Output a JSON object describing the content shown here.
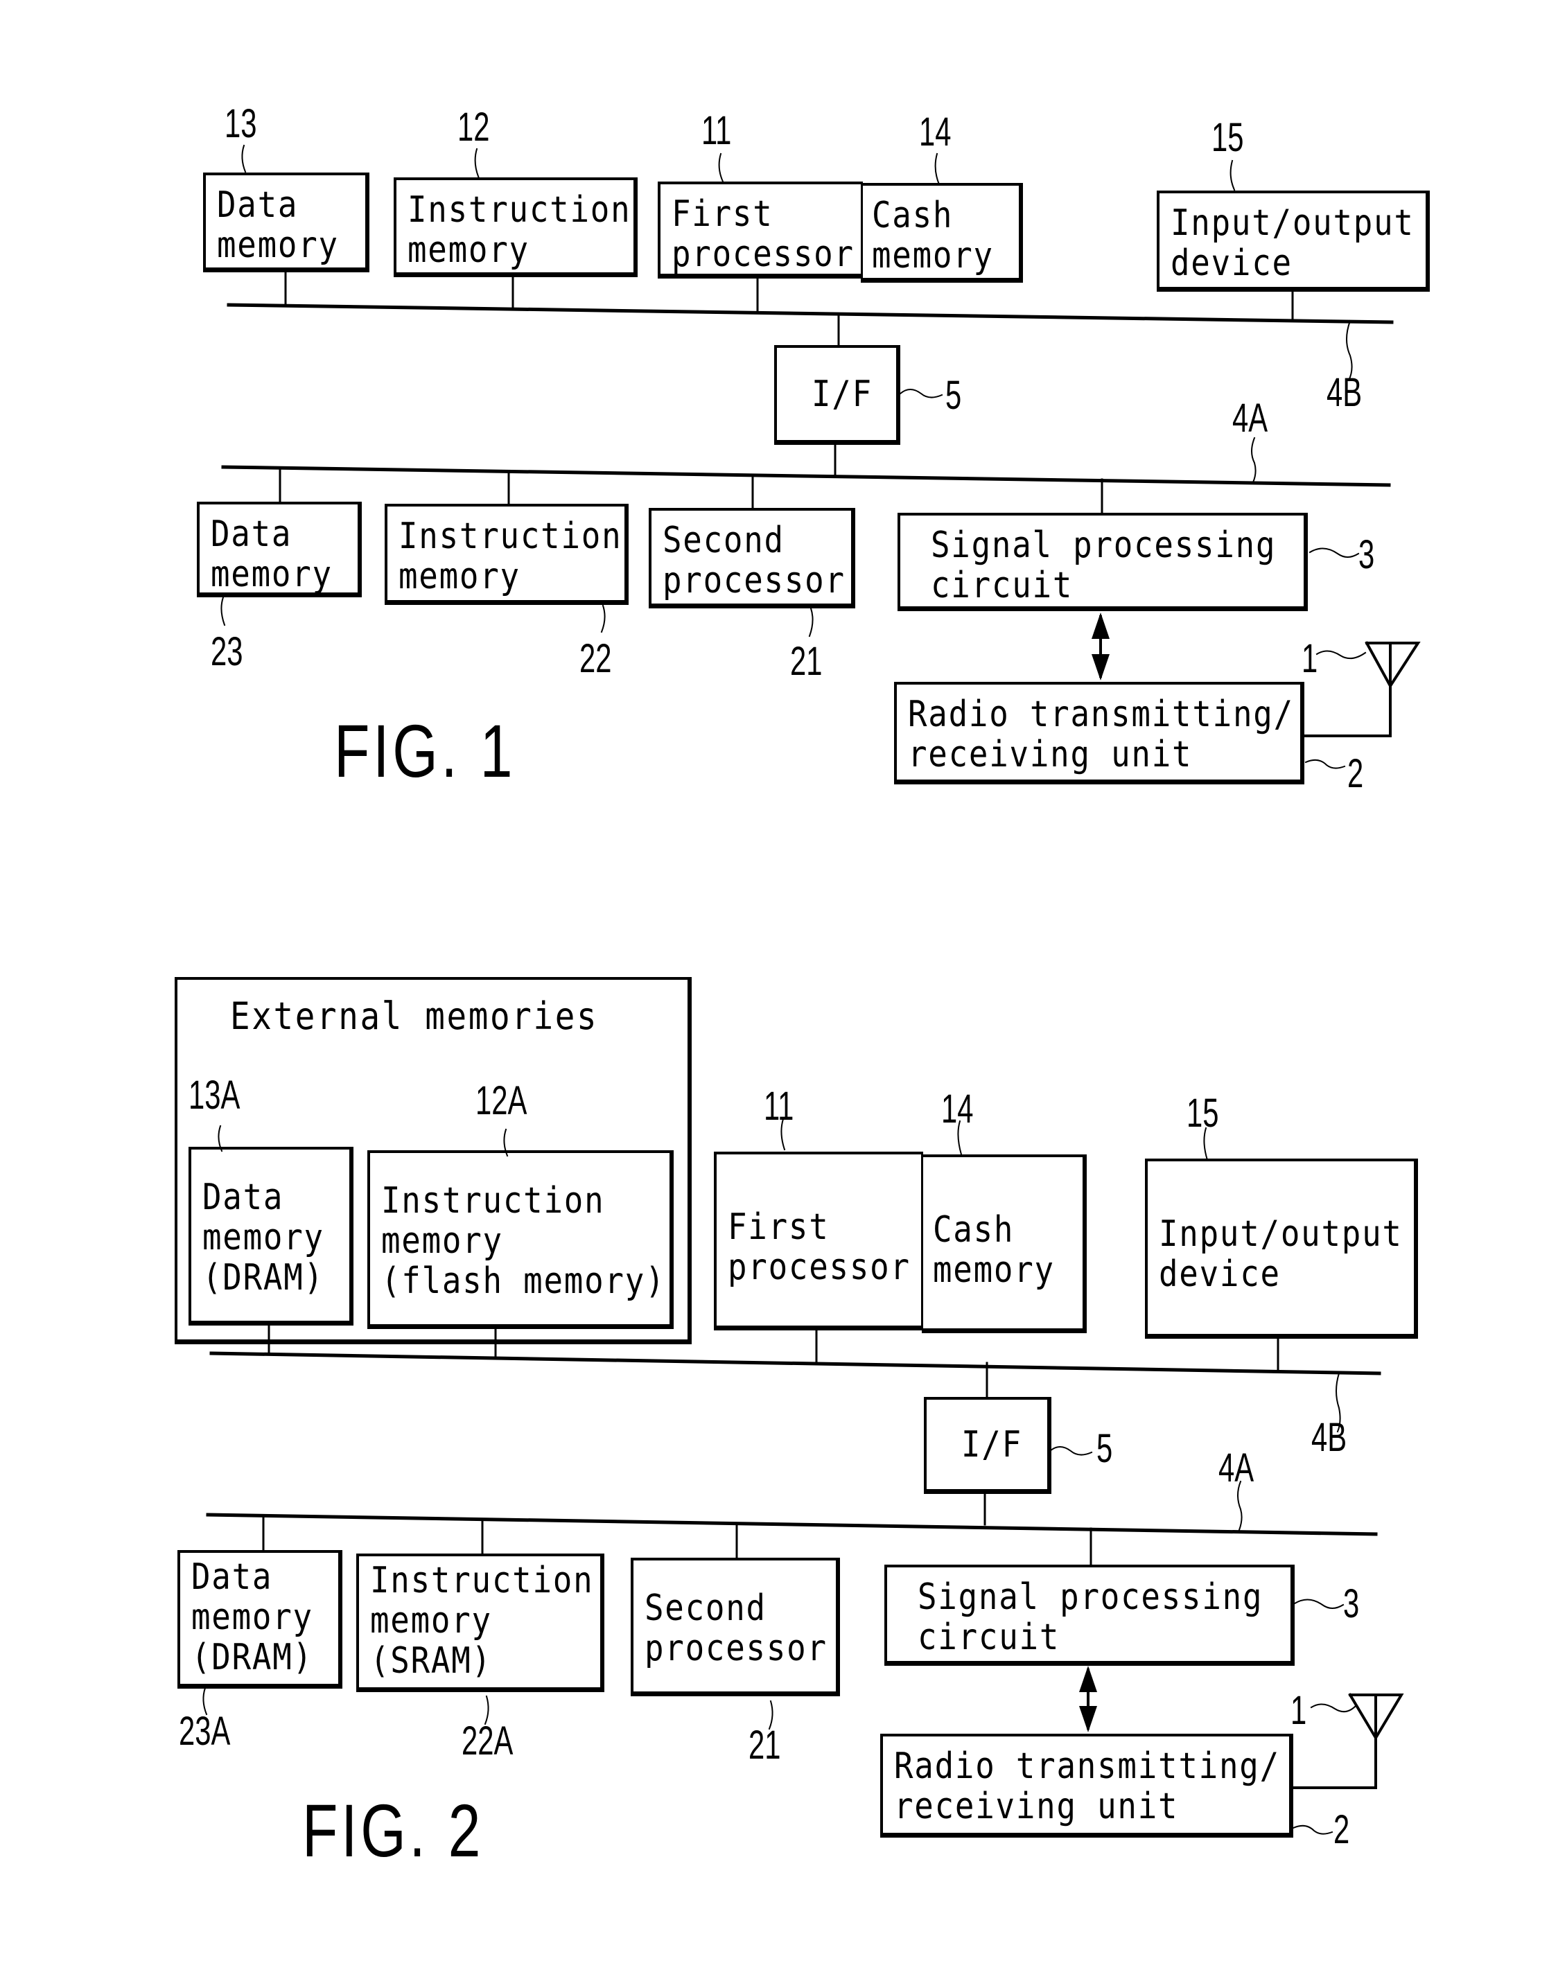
{
  "figures": [
    {
      "caption": "FIG. 1",
      "blocks": {
        "data_memory": {
          "ref": "13",
          "label": "Data\nmemory"
        },
        "instruction_memory": {
          "ref": "12",
          "label": "Instruction\nmemory"
        },
        "first_processor": {
          "ref": "11",
          "label": "First\nprocessor"
        },
        "cash_memory": {
          "ref": "14",
          "label": "Cash\nmemory"
        },
        "io_device": {
          "ref": "15",
          "label": "Input/output\ndevice"
        },
        "interface": {
          "ref": "5",
          "label": "I/F"
        },
        "data_memory_2": {
          "ref": "23",
          "label": "Data\nmemory"
        },
        "instruction_memory_2": {
          "ref": "22",
          "label": "Instruction\nmemory"
        },
        "second_processor": {
          "ref": "21",
          "label": "Second\nprocessor"
        },
        "signal_processing": {
          "ref": "3",
          "label": "Signal processing\ncircuit"
        },
        "radio_unit": {
          "ref": "2",
          "label": "Radio transmitting/\nreceiving unit"
        }
      },
      "buses": {
        "upper": "4B",
        "lower": "4A"
      },
      "antenna_ref": "1"
    },
    {
      "caption": "FIG. 2",
      "external_group_label": "External memories",
      "blocks": {
        "data_memory": {
          "ref": "13A",
          "label": "Data\nmemory\n(DRAM)"
        },
        "instruction_memory": {
          "ref": "12A",
          "label": "Instruction\nmemory\n(flash memory)"
        },
        "first_processor": {
          "ref": "11",
          "label": "First\nprocessor"
        },
        "cash_memory": {
          "ref": "14",
          "label": "Cash\nmemory"
        },
        "io_device": {
          "ref": "15",
          "label": "Input/output\ndevice"
        },
        "interface": {
          "ref": "5",
          "label": "I/F"
        },
        "data_memory_2": {
          "ref": "23A",
          "label": "Data\nmemory\n(DRAM)"
        },
        "instruction_memory_2": {
          "ref": "22A",
          "label": "Instruction\nmemory\n(SRAM)"
        },
        "second_processor": {
          "ref": "21",
          "label": "Second\nprocessor"
        },
        "signal_processing": {
          "ref": "3",
          "label": "Signal processing\ncircuit"
        },
        "radio_unit": {
          "ref": "2",
          "label": "Radio transmitting/\nreceiving unit"
        }
      },
      "buses": {
        "upper": "4B",
        "lower": "4A"
      },
      "antenna_ref": "1"
    }
  ]
}
